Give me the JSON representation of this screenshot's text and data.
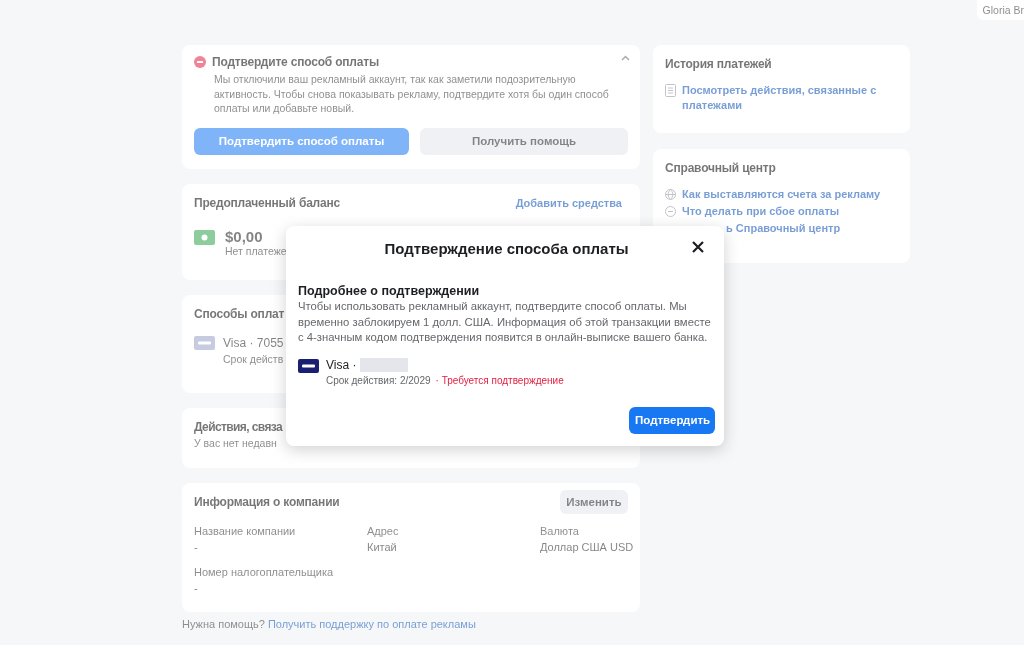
{
  "account_chip": {
    "name": "Gloria Br"
  },
  "alert": {
    "title": "Подтвердите способ оплаты",
    "message": "Мы отключили ваш рекламный аккаунт, так как заметили подозрительную активность. Чтобы снова показывать рекламу, подтвердите хотя бы один способ оплаты или добавьте новый.",
    "expanded": true,
    "buttons": [
      {
        "label": "Подтвердить способ оплаты",
        "kind": "primary"
      },
      {
        "label": "Получить помощь",
        "kind": "secondary"
      }
    ]
  },
  "prepaid_balance": {
    "title": "Предоплаченный баланс",
    "action": "Добавить средства",
    "amount": "$0,00",
    "note": "Нет платеже"
  },
  "payment_methods": {
    "title": "Способы оплат",
    "cards": [
      {
        "label": "Visa · 7055",
        "expiry": "Срок действ"
      }
    ]
  },
  "activity": {
    "title": "Действия, связа",
    "note": "У вас нет недавн"
  },
  "company_info": {
    "title": "Информация о компании",
    "edit_button": "Изменить",
    "fields": [
      {
        "label": "Название компании",
        "value": "-"
      },
      {
        "label": "Адрес",
        "value": "Китай"
      },
      {
        "label": "Валюта",
        "value": "Доллар США USD"
      },
      {
        "label": "Номер налогоплательщика",
        "value": "-"
      }
    ]
  },
  "footer": {
    "text": "Нужна помощь?",
    "link": "Получить поддержку по оплате рекламы"
  },
  "payment_history": {
    "title": "История платежей",
    "link": "Посмотреть действия, связанные с платежами"
  },
  "help_center": {
    "title": "Справочный центр",
    "links": [
      {
        "kind": "globe",
        "label": "Как выставляются счета за рекламу"
      },
      {
        "kind": "minus-circle",
        "label": "Что делать при сбое оплаты"
      },
      {
        "kind": "covered",
        "label": "ь Справочный центр"
      }
    ]
  },
  "modal": {
    "title": "Подтверждение способа оплаты",
    "subtitle": "Подробнее о подтверждении",
    "text": "Чтобы использовать рекламный аккаунт, подтвердите способ оплаты. Мы временно заблокируем 1 долл. США. Информация об этой транзакции вместе с 4-значным кодом подтверждения появится в онлайн-выписке вашего банка.",
    "card": {
      "label": "Visa ·",
      "expiry": "Срок действия: 2/2029",
      "status": "· Требуется подтверждение"
    },
    "confirm_button": "Подтвердить"
  }
}
